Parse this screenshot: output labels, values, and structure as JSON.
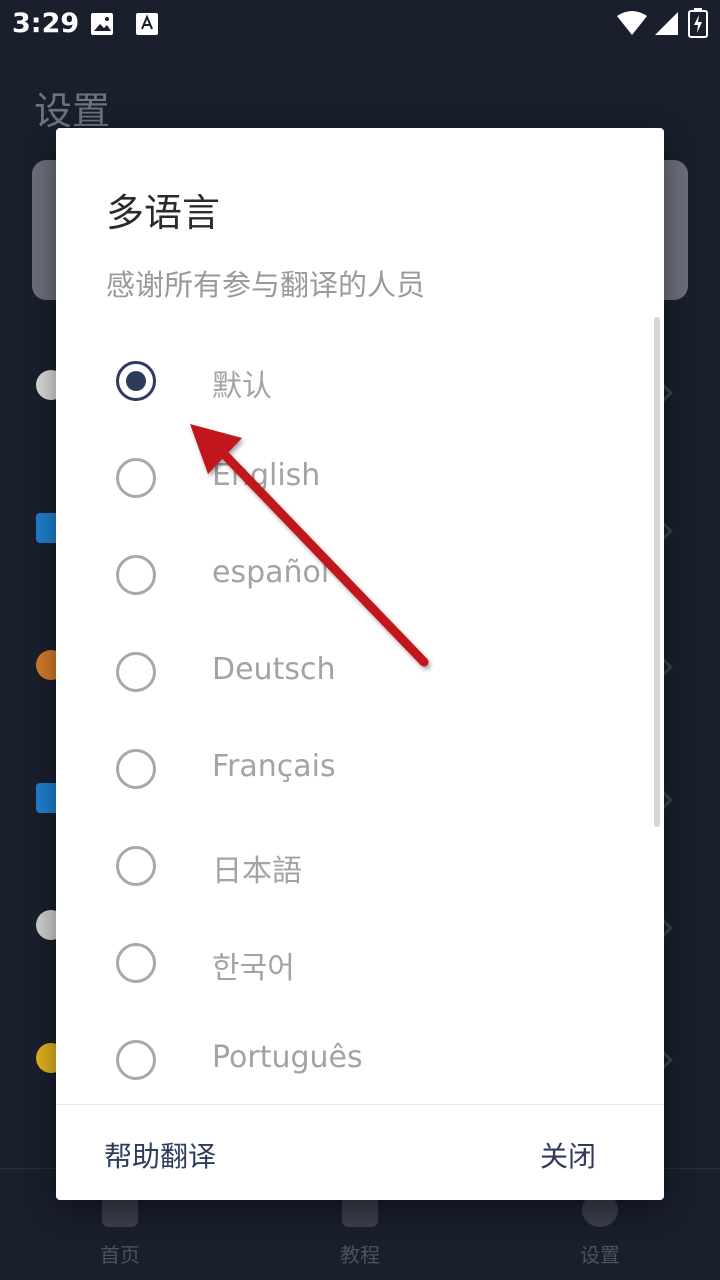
{
  "status_bar": {
    "time": "3:29",
    "icons": [
      "image-icon",
      "a-icon",
      "wifi-icon",
      "signal-icon",
      "battery-icon"
    ]
  },
  "background": {
    "page_title": "设置",
    "bottom_nav": [
      {
        "label": "首页",
        "icon": "home-icon"
      },
      {
        "label": "教程",
        "icon": "book-icon"
      },
      {
        "label": "设置",
        "icon": "smile-icon"
      }
    ]
  },
  "dialog": {
    "title": "多语言",
    "subtitle": "感谢所有参与翻译的人员",
    "selected_index": 0,
    "options": [
      {
        "label": "默认",
        "selected": true
      },
      {
        "label": "English",
        "selected": false
      },
      {
        "label": "español",
        "selected": false
      },
      {
        "label": "Deutsch",
        "selected": false
      },
      {
        "label": "Français",
        "selected": false
      },
      {
        "label": "日本語",
        "selected": false
      },
      {
        "label": "한국어",
        "selected": false
      },
      {
        "label": "Português",
        "selected": false
      }
    ],
    "buttons": {
      "help": "帮助翻译",
      "close": "关闭"
    }
  },
  "colors": {
    "accent": "#2f3b5c",
    "arrow": "#c0141b",
    "background": "#1a1f2e"
  }
}
